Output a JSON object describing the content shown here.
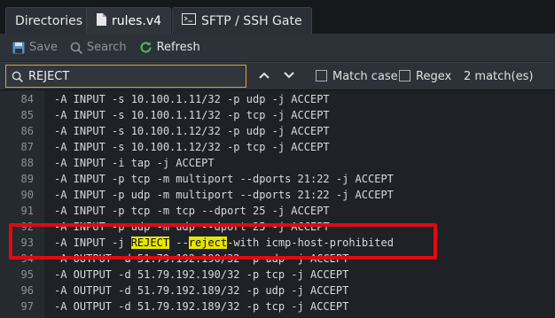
{
  "tabs": [
    {
      "label": "Directories"
    },
    {
      "label": "rules.v4"
    },
    {
      "label": "SFTP / SSH Gate"
    }
  ],
  "toolbar": {
    "save": "Save",
    "search": "Search",
    "refresh": "Refresh"
  },
  "search": {
    "value": "REJECT",
    "match_case": "Match case",
    "regex": "Regex",
    "matches": "2 match(es)",
    "up": "^",
    "down": "v"
  },
  "lines": [
    {
      "n": "84",
      "text": "-A INPUT -s 10.100.1.11/32 -p udp -j ACCEPT"
    },
    {
      "n": "85",
      "text": "-A INPUT -s 10.100.1.11/32 -p tcp -j ACCEPT"
    },
    {
      "n": "86",
      "text": "-A INPUT -s 10.100.1.12/32 -p udp -j ACCEPT"
    },
    {
      "n": "87",
      "text": "-A INPUT -s 10.100.1.12/32 -p tcp -j ACCEPT"
    },
    {
      "n": "88",
      "text": "-A INPUT -i tap -j ACCEPT"
    },
    {
      "n": "89",
      "text": "-A INPUT -p tcp -m multiport --dports 21:22 -j ACCEPT"
    },
    {
      "n": "90",
      "text": "-A INPUT -p udp -m multiport --dports 21:22 -j ACCEPT"
    },
    {
      "n": "91",
      "text": "-A INPUT -p tcp -m tcp --dport 25 -j ACCEPT"
    },
    {
      "n": "92",
      "text": "-A INPUT -p udp -m udp --dport 25 -j ACCEPT"
    },
    {
      "n": "93",
      "pre": "-A INPUT -j ",
      "hl1": "REJECT",
      "mid": " --",
      "hl2": "reject",
      "post": "-with icmp-host-prohibited"
    },
    {
      "n": "94",
      "text": "-A OUTPUT -d 51.79.192.190/32 -p udp -j ACCEPT"
    },
    {
      "n": "95",
      "text": "-A OUTPUT -d 51.79.192.190/32 -p tcp -j ACCEPT"
    },
    {
      "n": "96",
      "text": "-A OUTPUT -d 51.79.192.189/32 -p udp -j ACCEPT"
    },
    {
      "n": "97",
      "text": "-A OUTPUT -d 51.79.192.189/32 -p tcp -j ACCEPT"
    }
  ]
}
